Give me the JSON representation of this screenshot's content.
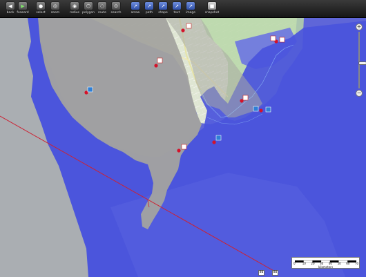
{
  "toolbar": {
    "buttons": [
      {
        "id": "back",
        "label": "back",
        "icon": "back-arrow-icon"
      },
      {
        "id": "forward",
        "label": "forward",
        "icon": "play-forward-icon"
      },
      {
        "id": "select",
        "label": "select",
        "icon": "person-select-icon"
      },
      {
        "id": "zoom",
        "label": "zoom",
        "icon": "zoom-icon"
      },
      {
        "id": "radius",
        "label": "radius",
        "icon": "radius-icon"
      },
      {
        "id": "polygon",
        "label": "polygon",
        "icon": "polygon-icon"
      },
      {
        "id": "route",
        "label": "route",
        "icon": "route-icon"
      },
      {
        "id": "search",
        "label": "search",
        "icon": "search-icon"
      },
      {
        "id": "arrow",
        "label": "arrow",
        "icon": "arrow-draw-icon"
      },
      {
        "id": "path",
        "label": "path",
        "icon": "path-draw-icon"
      },
      {
        "id": "shape",
        "label": "shape",
        "icon": "shape-draw-icon"
      },
      {
        "id": "text",
        "label": "text",
        "icon": "text-draw-icon"
      },
      {
        "id": "image",
        "label": "image",
        "icon": "image-draw-icon"
      },
      {
        "id": "snapshot",
        "label": "snapshot",
        "icon": "camera-icon"
      }
    ]
  },
  "zoom": {
    "plus_label": "+",
    "minus_label": "−",
    "level": 0.55
  },
  "scalebar": {
    "ticks": [
      "0",
      "10",
      "20",
      "30",
      "40",
      "50",
      "60",
      "70"
    ],
    "unit": "kilometers"
  },
  "highway_shields": [
    "80",
    "80"
  ],
  "colors": {
    "ocean": "#5f66d8",
    "flood_zone": "#4a54dc",
    "land_base": "#c9cfbf",
    "gray_overlay": "#a3a39f",
    "accent_red": "#d4122a",
    "route_line": "#cc2233"
  }
}
